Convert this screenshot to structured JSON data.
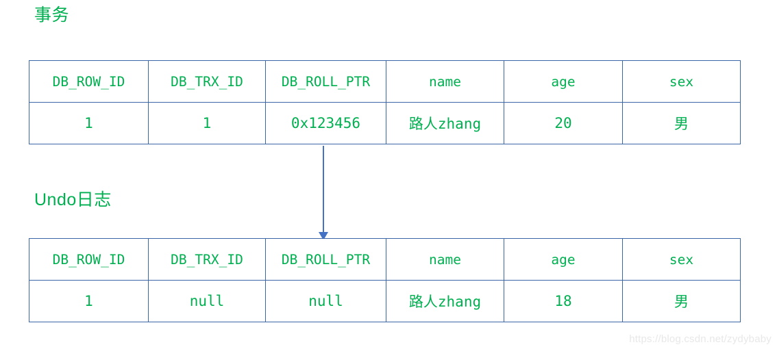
{
  "sections": {
    "transaction": {
      "title": "事务"
    },
    "undo_log": {
      "title": "Undo日志"
    }
  },
  "colors": {
    "text_green": "#00b050",
    "border_blue": "#3a66a8",
    "arrow_blue": "#4472c4",
    "watermark_gray": "#e8e8e8",
    "background": "#ffffff"
  },
  "tables": {
    "transaction": {
      "columns": [
        "DB_ROW_ID",
        "DB_TRX_ID",
        "DB_ROLL_PTR",
        "name",
        "age",
        "sex"
      ],
      "rows": [
        [
          "1",
          "1",
          "0x123456",
          "路人zhang",
          "20",
          "男"
        ]
      ]
    },
    "undo_log": {
      "columns": [
        "DB_ROW_ID",
        "DB_TRX_ID",
        "DB_ROLL_PTR",
        "name",
        "age",
        "sex"
      ],
      "rows": [
        [
          "1",
          "null",
          "null",
          "路人zhang",
          "18",
          "男"
        ]
      ]
    }
  },
  "arrow": {
    "icon": "down-arrow-icon",
    "from": "transaction-table",
    "to": "undo-log-table"
  },
  "watermark": {
    "text": "https://blog.csdn.net/zydybaby"
  }
}
